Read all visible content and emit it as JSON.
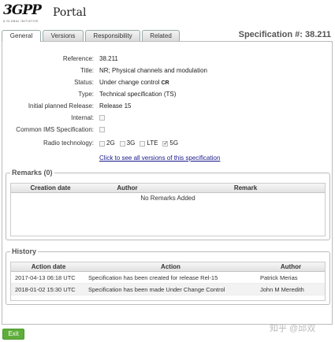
{
  "header": {
    "logo_text": "3GPP",
    "logo_tagline": "A GLOBAL INITIATIVE",
    "portal_title": "Portal",
    "spec_label": "Specification #: 38.211"
  },
  "tabs": [
    {
      "label": "General",
      "active": true
    },
    {
      "label": "Versions",
      "active": false
    },
    {
      "label": "Responsibility",
      "active": false
    },
    {
      "label": "Related",
      "active": false
    }
  ],
  "details": {
    "reference_label": "Reference:",
    "reference_value": "38.211",
    "title_label": "Title:",
    "title_value": "NR; Physical channels and modulation",
    "status_label": "Status:",
    "status_value": "Under change control",
    "status_badge": "CR",
    "type_label": "Type:",
    "type_value": "Technical specification (TS)",
    "release_label": "Initial planned Release:",
    "release_value": "Release 15",
    "internal_label": "Internal:",
    "ims_label": "Common IMS Specification:",
    "radio_label": "Radio technology:",
    "radio_options": [
      {
        "label": "2G",
        "checked": false
      },
      {
        "label": "3G",
        "checked": false
      },
      {
        "label": "LTE",
        "checked": false
      },
      {
        "label": "5G",
        "checked": true
      }
    ],
    "versions_link": "Click to see all versions of this specification"
  },
  "remarks": {
    "legend": "Remarks (0)",
    "columns": [
      "Creation date",
      "Author",
      "Remark"
    ],
    "empty_message": "No Remarks Added"
  },
  "history": {
    "legend": "History",
    "columns": [
      "Action date",
      "Action",
      "Author"
    ],
    "rows": [
      {
        "date": "2017-04-13 06:18 UTC",
        "action": "Specification has been created for release Rel-15",
        "author": "Patrick Merias"
      },
      {
        "date": "2018-01-02 15:30 UTC",
        "action": "Specification has been made Under Change Control",
        "author": "John M Meredith"
      }
    ]
  },
  "footer": {
    "exit_label": "Exit",
    "watermark": "知乎 @邱双"
  }
}
